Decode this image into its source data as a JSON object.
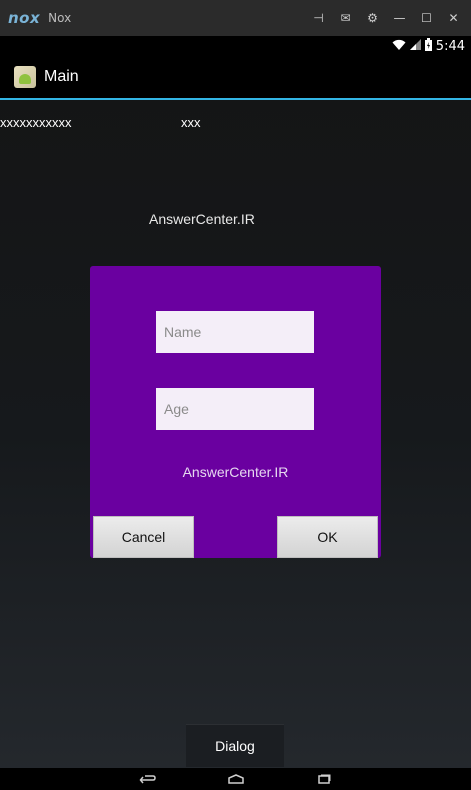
{
  "emulator": {
    "logo": "nox",
    "title": "Nox",
    "controls": [
      {
        "name": "pin-icon",
        "glyph": "⊣"
      },
      {
        "name": "mail-icon",
        "glyph": "✉"
      },
      {
        "name": "settings-icon",
        "glyph": "⚙"
      },
      {
        "name": "minimize-icon",
        "glyph": "—"
      },
      {
        "name": "maximize-icon",
        "glyph": "☐"
      },
      {
        "name": "close-icon",
        "glyph": "✕"
      }
    ]
  },
  "status_bar": {
    "time": "5:44",
    "icons": [
      "wifi-icon",
      "signal-icon",
      "battery-icon"
    ]
  },
  "action_bar": {
    "title": "Main",
    "icon": "app-android-icon"
  },
  "content": {
    "text1": "xxxxxxxxxxx",
    "text2": "xxx",
    "center_label": "AnswerCenter.IR"
  },
  "dialog": {
    "name_placeholder": "Name",
    "age_placeholder": "Age",
    "label": "AnswerCenter.IR",
    "cancel_label": "Cancel",
    "ok_label": "OK",
    "background_color": "#6a00a0"
  },
  "open_dialog_button": {
    "label": "Dialog"
  },
  "nav_bar": {
    "back": "back-icon",
    "home": "home-icon",
    "recents": "recents-icon"
  }
}
